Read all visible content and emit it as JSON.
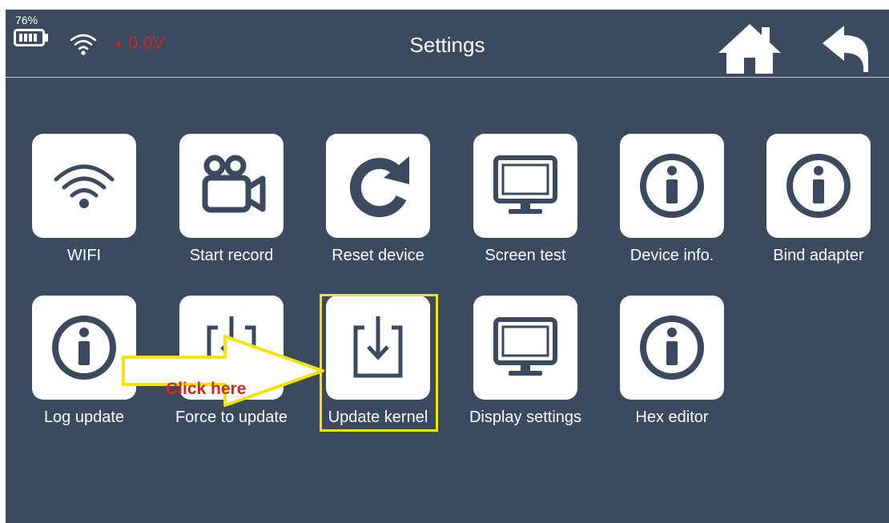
{
  "status": {
    "battery_percent": "76%",
    "voltage": "0.0V"
  },
  "header": {
    "title": "Settings"
  },
  "grid": {
    "row1": [
      {
        "label": "WIFI",
        "icon": "wifi-icon"
      },
      {
        "label": "Start record",
        "icon": "video-camera-icon"
      },
      {
        "label": "Reset device",
        "icon": "refresh-icon"
      },
      {
        "label": "Screen test",
        "icon": "monitor-icon"
      },
      {
        "label": "Device info.",
        "icon": "info-icon"
      },
      {
        "label": "Bind adapter",
        "icon": "info-icon"
      }
    ],
    "row2": [
      {
        "label": "Log update",
        "icon": "info-icon"
      },
      {
        "label": "Force to update",
        "icon": "download-box-icon"
      },
      {
        "label": "Update kernel",
        "icon": "download-box-icon"
      },
      {
        "label": "Display settings",
        "icon": "monitor-icon"
      },
      {
        "label": "Hex editor",
        "icon": "info-icon"
      }
    ]
  },
  "annotation": {
    "callout": "Click here"
  },
  "colors": {
    "background": "#3b4a5e",
    "tile": "#ffffff",
    "icon": "#3b4a5e",
    "highlight": "#f5e400",
    "callout_text": "#d4271b",
    "voltage": "#c8261e"
  }
}
